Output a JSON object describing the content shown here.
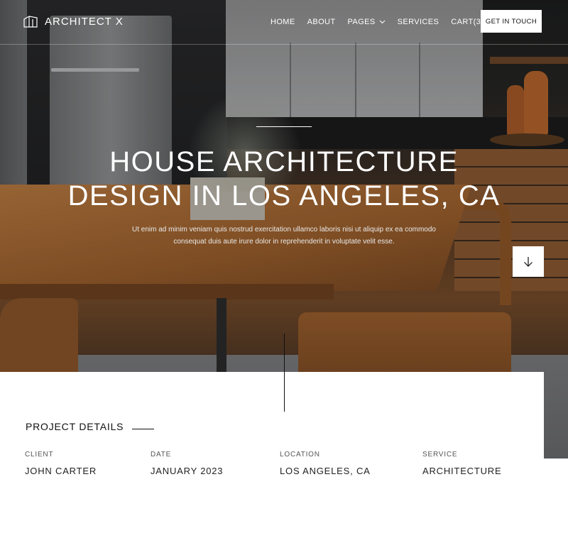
{
  "nav": {
    "brand": "ARCHITECT X",
    "items": [
      {
        "label": "HOME"
      },
      {
        "label": "ABOUT"
      },
      {
        "label": "PAGES",
        "has_dropdown": true
      },
      {
        "label": "SERVICES"
      },
      {
        "label": "CART(3)"
      }
    ],
    "cta_label": "GET IN TOUCH"
  },
  "hero": {
    "title_line1": "HOUSE ARCHITECTURE",
    "title_line2": "DESIGN IN LOS ANGELES, CA",
    "subtitle": "Ut enim ad minim veniam quis nostrud exercitation ullamco laboris nisi ut aliquip ex ea commodo consequat duis aute irure dolor in reprehenderit in voluptate velit esse.",
    "scroll_icon": "arrow-down-icon"
  },
  "details": {
    "heading": "PROJECT DETAILS",
    "items": [
      {
        "label": "CLIENT",
        "value": "JOHN CARTER"
      },
      {
        "label": "DATE",
        "value": "JANUARY 2023"
      },
      {
        "label": "LOCATION",
        "value": "LOS ANGELES, CA"
      },
      {
        "label": "SERVICE",
        "value": "ARCHITECTURE"
      }
    ]
  },
  "colors": {
    "cta_bg": "#ffffff",
    "text_dark": "#111111",
    "accent_wood": "#a36a3a"
  }
}
